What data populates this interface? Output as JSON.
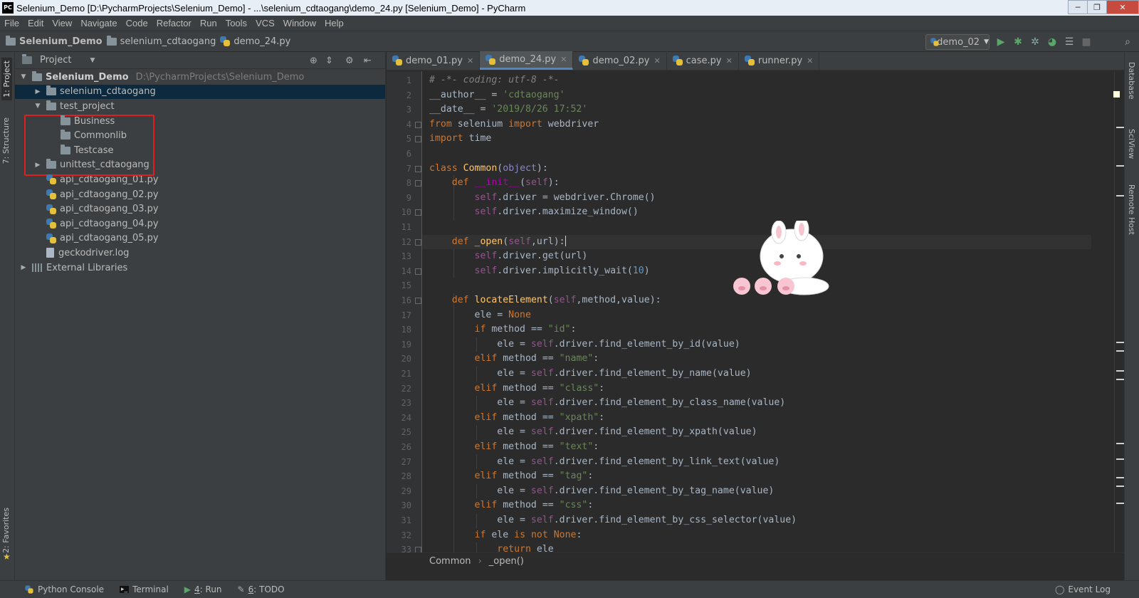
{
  "window": {
    "title": "Selenium_Demo [D:\\PycharmProjects\\Selenium_Demo] - ...\\selenium_cdtaogang\\demo_24.py [Selenium_Demo] - PyCharm",
    "app_icon_text": "PC",
    "controls": [
      "─",
      "❐",
      "✕"
    ]
  },
  "menu": [
    "File",
    "Edit",
    "View",
    "Navigate",
    "Code",
    "Refactor",
    "Run",
    "Tools",
    "VCS",
    "Window",
    "Help"
  ],
  "navbar": {
    "crumbs": [
      "Selenium_Demo",
      "selenium_cdtaogang",
      "demo_24.py"
    ],
    "run_config": "demo_02"
  },
  "left_stripe": {
    "project_tab": "1: Project",
    "structure_tab": "7: Structure",
    "favorites_tab": "2: Favorites"
  },
  "right_stripe": {
    "database": "Database",
    "sciview": "SciView",
    "remote_host": "Remote Host"
  },
  "project": {
    "header": "Project",
    "tree": [
      {
        "label": "Selenium_Demo",
        "path": "D:\\PycharmProjects\\Selenium_Demo",
        "type": "folder",
        "depth": 0,
        "expanded": true
      },
      {
        "label": "selenium_cdtaogang",
        "type": "folder",
        "depth": 1,
        "expanded": false,
        "selected": true
      },
      {
        "label": "test_project",
        "type": "folder",
        "depth": 1,
        "expanded": true
      },
      {
        "label": "Business",
        "type": "folder",
        "depth": 2
      },
      {
        "label": "Commonlib",
        "type": "folder",
        "depth": 2
      },
      {
        "label": "Testcase",
        "type": "folder",
        "depth": 2
      },
      {
        "label": "unittest_cdtaogang",
        "type": "folder",
        "depth": 1,
        "expanded": false
      },
      {
        "label": "api_cdtaogang_01.py",
        "type": "py",
        "depth": 1
      },
      {
        "label": "api_cdtaogang_02.py",
        "type": "py",
        "depth": 1
      },
      {
        "label": "api_cdtaogang_03.py",
        "type": "py",
        "depth": 1
      },
      {
        "label": "api_cdtaogang_04.py",
        "type": "py",
        "depth": 1
      },
      {
        "label": "api_cdtaogang_05.py",
        "type": "py",
        "depth": 1
      },
      {
        "label": "geckodriver.log",
        "type": "file",
        "depth": 1
      },
      {
        "label": "External Libraries",
        "type": "lib",
        "depth": 0,
        "expanded": false
      }
    ]
  },
  "editor": {
    "tabs": [
      {
        "label": "demo_01.py",
        "active": false
      },
      {
        "label": "demo_24.py",
        "active": true
      },
      {
        "label": "demo_02.py",
        "active": false
      },
      {
        "label": "case.py",
        "active": false
      },
      {
        "label": "runner.py",
        "active": false
      }
    ],
    "lines": [
      "<span class=\"c\"># -*- coding: utf-8 -*-</span>",
      "__author__ = <span class=\"s\">'cdtaogang'</span>",
      "__date__ = <span class=\"s\">'2019/8/26 17:52'</span>",
      "<span class=\"k\">from</span> selenium <span class=\"k\">import</span> webdriver",
      "<span class=\"k\">import</span> time",
      "",
      "<span class=\"k\">class</span> <span class=\"fn\">Common</span>(<span class=\"bi\">object</span>):",
      "    <span class=\"k\">def</span> <span class=\"dn\">__init__</span>(<span class=\"slf\">self</span>):",
      "        <span class=\"slf\">self</span>.driver = webdriver.Chrome()",
      "        <span class=\"slf\">self</span>.driver.maximize_window()",
      "",
      "    <span class=\"k\">def</span> <span class=\"fn\">_open</span>(<span class=\"slf\">self</span>,url):",
      "        <span class=\"slf\">self</span>.driver.get(url)",
      "        <span class=\"slf\">self</span>.driver.implicitly_wait(<span class=\"nm\">10</span>)",
      "",
      "    <span class=\"k\">def</span> <span class=\"fn\">locateElement</span>(<span class=\"slf\">self</span>,method,value):",
      "        ele = <span class=\"k\">None</span>",
      "        <span class=\"k\">if</span> method == <span class=\"s\">\"id\"</span>:",
      "            ele = <span class=\"slf\">self</span>.driver.find_element_by_id(value)",
      "        <span class=\"k\">elif</span> method == <span class=\"s\">\"name\"</span>:",
      "            ele = <span class=\"slf\">self</span>.driver.find_element_by_name(value)",
      "        <span class=\"k\">elif</span> method == <span class=\"s\">\"class\"</span>:",
      "            ele = <span class=\"slf\">self</span>.driver.find_element_by_class_name(value)",
      "        <span class=\"k\">elif</span> method == <span class=\"s\">\"xpath\"</span>:",
      "            ele = <span class=\"slf\">self</span>.driver.find_element_by_xpath(value)",
      "        <span class=\"k\">elif</span> method == <span class=\"s\">\"text\"</span>:",
      "            ele = <span class=\"slf\">self</span>.driver.find_element_by_link_text(value)",
      "        <span class=\"k\">elif</span> method == <span class=\"s\">\"tag\"</span>:",
      "            ele = <span class=\"slf\">self</span>.driver.find_element_by_tag_name(value)",
      "        <span class=\"k\">elif</span> method == <span class=\"s\">\"css\"</span>:",
      "            ele = <span class=\"slf\">self</span>.driver.find_element_by_css_selector(value)",
      "        <span class=\"k\">if</span> ele <span class=\"k\">is not</span> <span class=\"k\">None</span>:",
      "            <span class=\"k\">return</span> ele"
    ],
    "current_line": 12,
    "breadcrumb": [
      "Common",
      "_open()"
    ]
  },
  "statusbar": {
    "python_console": "Python Console",
    "terminal": "Terminal",
    "run_num": "4",
    "run": ": Run",
    "todo_num": "6",
    "todo": ": TODO",
    "event_log": "Event Log"
  },
  "colors": {
    "accent": "#4a88c7",
    "highlight_box": "#e02020",
    "selection": "#0d293e"
  }
}
